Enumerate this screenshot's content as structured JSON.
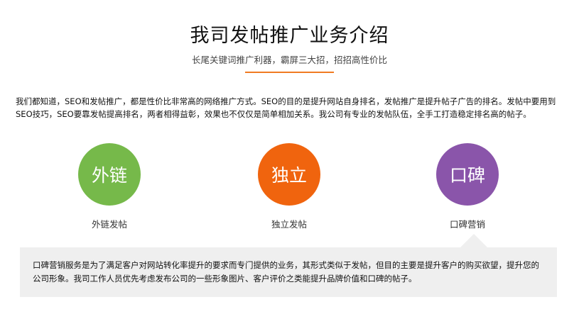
{
  "header": {
    "title": "我司发帖推广业务介绍",
    "subtitle": "长尾关键词推广利器，霸屏三大招，招招高性价比",
    "accent_color": "#f07b22"
  },
  "intro": {
    "text": "我们都知道，SEO和发帖推广，都是性价比非常高的网络推广方式。SEO的目的是提升网站自身排名，发帖推广是提升帖子广告的排名。发帖中要用到SEO技巧，SEO要靠发帖提高排名，两者相得益彰，效果也不仅仅是简单相加关系。我公司有专业的发帖队伍，全手工打造稳定排名高的帖子。"
  },
  "features": [
    {
      "circle_label": "外链",
      "caption": "外链发帖",
      "color": "#76b94a"
    },
    {
      "circle_label": "独立",
      "caption": "独立发帖",
      "color": "#f0640e"
    },
    {
      "circle_label": "口碑",
      "caption": "口碑营销",
      "color": "#8a55aa"
    }
  ],
  "detail_panel": {
    "text": "口碑营销服务是为了满足客户对网站转化率提升的要求而专门提供的业务，其形式类似于发帖，但目的主要是提升客户的购买欲望，提升您的公司形象。我司工作人员优先考虑发布公司的一些形象图片、客户评价之类能提升品牌价值和口碑的帖子。",
    "background_color": "#efefef"
  }
}
